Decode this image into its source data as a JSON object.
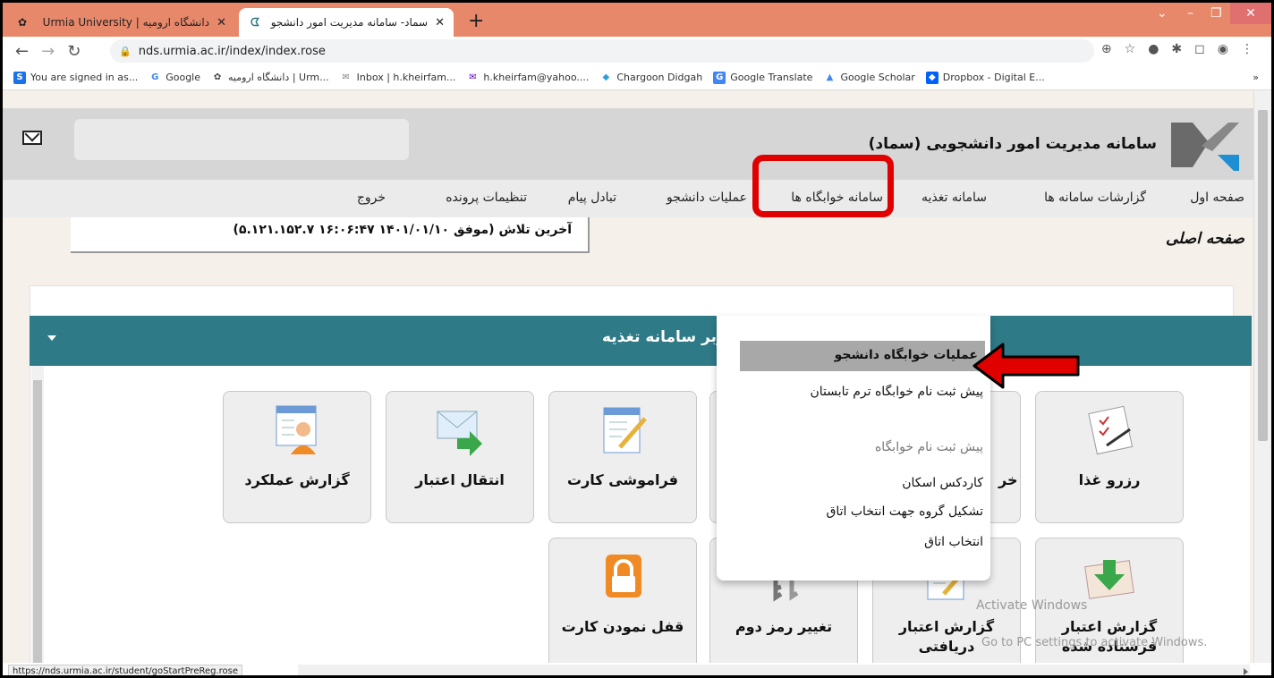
{
  "browser": {
    "tabs": [
      {
        "title": "دانشگاه ارومیه | Urmia University",
        "active": false
      },
      {
        "title": "سماد- سامانه مدیریت امور دانشجو",
        "active": true
      }
    ],
    "new_tab": "+",
    "url": "nds.urmia.ac.ir/index/index.rose",
    "bookmarks": [
      {
        "label": "You are signed in as...",
        "icon": "S",
        "color": "#1a73e8"
      },
      {
        "label": "Google",
        "icon": "G",
        "color": "#4285f4"
      },
      {
        "label": "دانشگاه ارومیه | Urm...",
        "icon": "✿",
        "color": "#444444"
      },
      {
        "label": "Inbox | h.kheirfam...",
        "icon": "✉",
        "color": "#888888"
      },
      {
        "label": "h.kheirfam@yahoo....",
        "icon": "✉",
        "color": "#5f01d1"
      },
      {
        "label": "Chargoon Didgah",
        "icon": "◆",
        "color": "#2aa0d8"
      },
      {
        "label": "Google Translate",
        "icon": "G",
        "color": "#4285f4"
      },
      {
        "label": "Google Scholar",
        "icon": "▲",
        "color": "#4285f4"
      },
      {
        "label": "Dropbox - Digital E...",
        "icon": "◆",
        "color": "#0061ff"
      }
    ],
    "more_bookmarks": "»",
    "status_url": "https://nds.urmia.ac.ir/student/goStartPreReg.rose"
  },
  "app": {
    "title": "سامانه مدیریت امور دانشجویی (سماد)",
    "menu": [
      "صفحه اول",
      "گزارشات سامانه ها",
      "سامانه تغذیه",
      "سامانه خوابگاه ها",
      "عملیات دانشجو",
      "تبادل پیام",
      "تنظیمات پرونده",
      "خروج"
    ],
    "last_try": "آخرین تلاش (موفق ۱۴۰۱/۰۱/۱۰ ۱۶:۰۶:۴۷ ۵.۱۲۱.۱۵۲.۷)",
    "breadcrumb": "صفحه اصلی",
    "panel_title": "کاربر سامانه تغذیه"
  },
  "dropdown": {
    "header": "عملیات خوابگاه دانشجو",
    "items": [
      "پیش ثبت نام خوابگاه ترم تابستان",
      "پیش ثبت نام خوابگاه",
      "کاردکس اسکان",
      "تشکیل گروه جهت انتخاب اتاق",
      "انتخاب اتاق"
    ]
  },
  "tiles": {
    "row1": [
      "رزرو غذا",
      "خر",
      "فراموشی کارت",
      "انتقال اعتبار",
      "گزارش عملکرد"
    ],
    "row2": [
      "گزارش اعتبار فرستاده شده",
      "گزارش اعتبار دریافتی",
      "تغییر رمز دوم",
      "قفل نمودن کارت"
    ]
  },
  "watermark": {
    "line1": "Activate Windows",
    "line2": "Go to PC settings to activate Windows."
  },
  "colors": {
    "tabbar": "#e8886a",
    "panel": "#2e7a86",
    "highlight": "#e00000"
  }
}
